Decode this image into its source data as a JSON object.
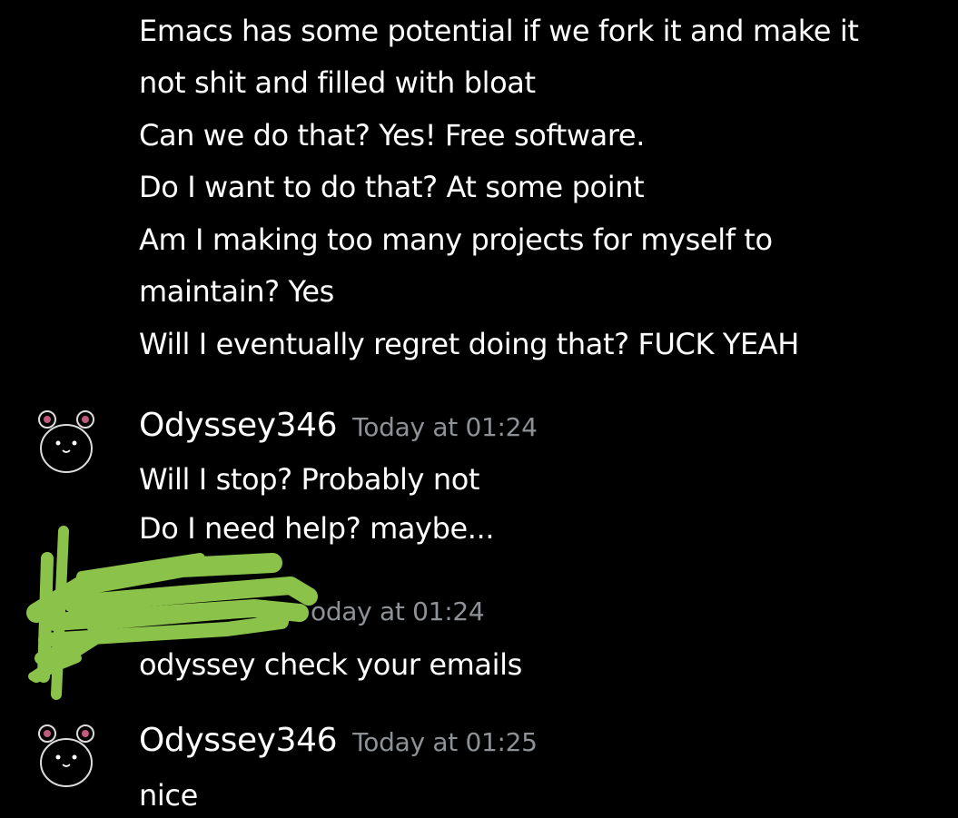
{
  "continued_lines": [
    "Emacs has some potential if we fork it and make it",
    "not shit and filled with bloat",
    "Can we do that? Yes! Free software.",
    "Do I want to do that? At some point",
    "Am I making too many projects for myself to",
    "maintain? Yes",
    "Will I eventually regret doing that? FUCK YEAH"
  ],
  "messages": [
    {
      "author": "Odyssey346",
      "timestamp": "Today at 01:24",
      "lines": [
        "Will I stop? Probably not",
        "Do I need help? maybe..."
      ]
    },
    {
      "author": "",
      "timestamp": "oday at 01:24",
      "lines": [
        "odyssey check your emails"
      ]
    },
    {
      "author": "Odyssey346",
      "timestamp": "Today at 01:25",
      "lines": [
        "nice"
      ]
    }
  ],
  "colors": {
    "background": "#000000",
    "text": "#ffffff",
    "timestamp": "#8e9297",
    "redaction": "#8bc34a"
  },
  "icons": {
    "avatar": "hamster-avatar-icon",
    "redaction": "redaction-scribble"
  }
}
